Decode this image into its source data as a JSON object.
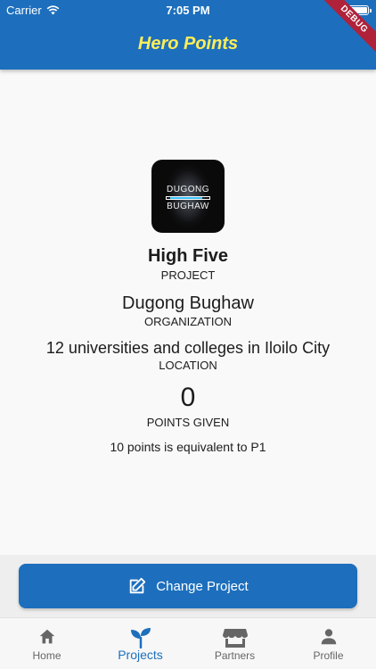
{
  "status_bar": {
    "carrier": "Carrier",
    "time": "7:05 PM"
  },
  "app_bar": {
    "title": "Hero Points",
    "debug_banner": "DEBUG"
  },
  "logo": {
    "line1": "DUGONG",
    "line2": "BUGHAW"
  },
  "project": {
    "name": "High Five",
    "label": "PROJECT"
  },
  "organization": {
    "name": "Dugong Bughaw",
    "label": "ORGANIZATION"
  },
  "location": {
    "name": "12 universities and colleges in Iloilo City",
    "label": "LOCATION"
  },
  "points": {
    "value": "0",
    "label": "POINTS GIVEN",
    "note": "10 points is equivalent to P1"
  },
  "action": {
    "label": "Change Project",
    "icon": "edit-icon"
  },
  "tabs": [
    {
      "label": "Home",
      "icon": "home-icon",
      "active": false
    },
    {
      "label": "Projects",
      "icon": "sprout-icon",
      "active": true
    },
    {
      "label": "Partners",
      "icon": "storefront-icon",
      "active": false
    },
    {
      "label": "Profile",
      "icon": "person-icon",
      "active": false
    }
  ],
  "colors": {
    "primary": "#1d6fbd",
    "title": "#ffee58",
    "debug": "#b0213a",
    "inactive_tab": "#666666"
  }
}
